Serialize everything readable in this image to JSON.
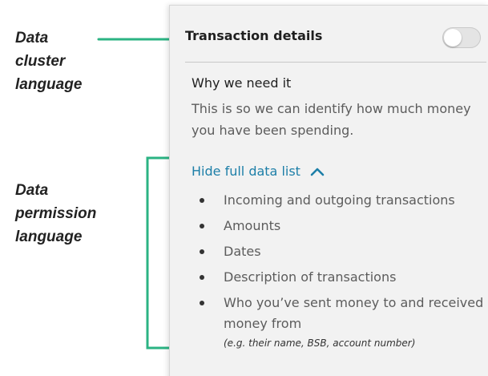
{
  "annotations": {
    "cluster": "Data\ncluster\nlanguage",
    "permission": "Data\npermission\nlanguage"
  },
  "colors": {
    "connector": "#2bb383",
    "link": "#1d7fa8"
  },
  "card": {
    "title": "Transaction details",
    "toggle_on": false,
    "why_heading": "Why we need it",
    "why_text": "This is so we can identify how much money you have been spending.",
    "link_label": "Hide full data list",
    "link_icon": "chevron-up-icon",
    "items": [
      {
        "text": "Incoming and outgoing transactions"
      },
      {
        "text": "Amounts"
      },
      {
        "text": "Dates"
      },
      {
        "text": "Description of transactions"
      },
      {
        "text": "Who you’ve sent money to and received money from",
        "note": "(e.g. their name, BSB, account number)"
      }
    ]
  }
}
